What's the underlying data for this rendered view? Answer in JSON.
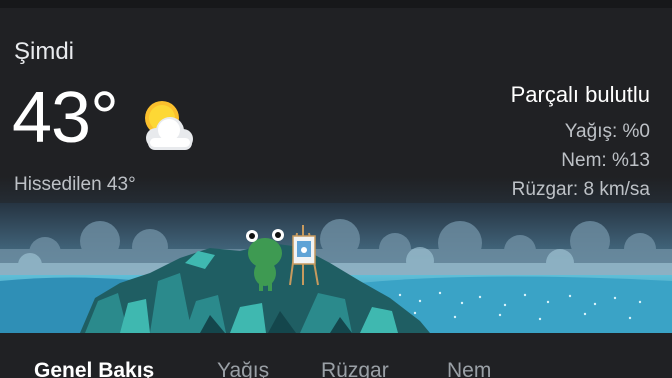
{
  "now": {
    "label": "Şimdi",
    "temperature": "43°",
    "feels_like": "Hissedilen 43°",
    "condition": "Parçalı bulutlu",
    "precipitation": "Yağış: %0",
    "humidity": "Nem: %13",
    "wind": "Rüzgar: 8 km/sa",
    "icon": "partly-cloudy-icon"
  },
  "tabs": [
    {
      "label": "Genel Bakış",
      "active": true
    },
    {
      "label": "Yağış",
      "active": false
    },
    {
      "label": "Rüzgar",
      "active": false
    },
    {
      "label": "Nem",
      "active": false
    }
  ],
  "colors": {
    "background": "#202124",
    "sun": "#fbc02d",
    "water": "#3fa9c7"
  }
}
